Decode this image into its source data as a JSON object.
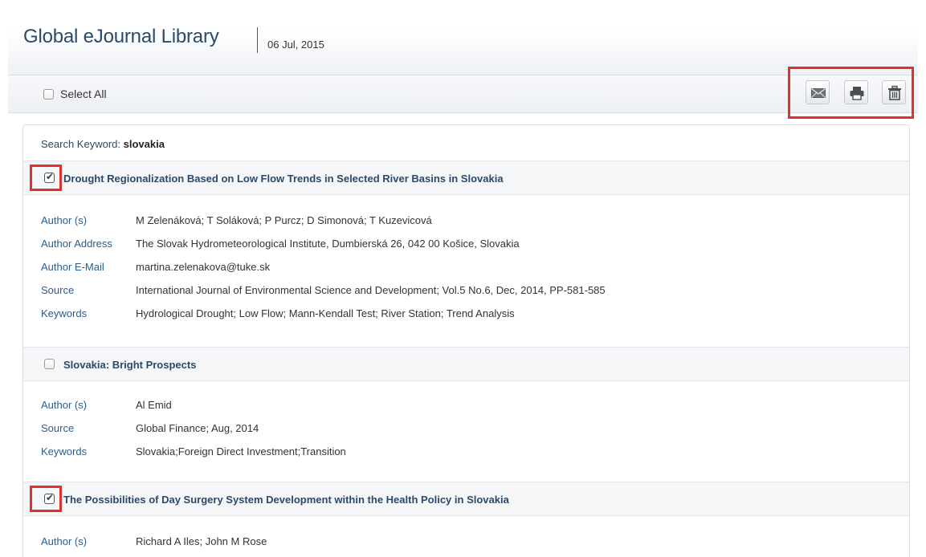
{
  "header": {
    "title": "Global eJournal Library",
    "date": "06 Jul, 2015"
  },
  "toolbar": {
    "select_all_label": "Select All",
    "actions": [
      {
        "icon": "envelope-icon",
        "label": "Email"
      },
      {
        "icon": "printer-icon",
        "label": "Print"
      },
      {
        "icon": "trash-icon",
        "label": "Delete"
      }
    ]
  },
  "search": {
    "label": "Search Keyword:",
    "keyword": "slovakia"
  },
  "records": [
    {
      "checked": true,
      "title": "Drought Regionalization Based on Low Flow Trends in Selected River Basins in Slovakia",
      "fields": [
        {
          "key": "Author (s)",
          "value": "M Zelenáková; T Soláková; P Purcz; D Simonová; T Kuzevicová"
        },
        {
          "key": "Author Address",
          "value": "The Slovak Hydrometeorological Institute, Dumbierská 26, 042 00 Košice, Slovakia"
        },
        {
          "key": "Author E-Mail",
          "value": "martina.zelenakova@tuke.sk"
        },
        {
          "key": "Source",
          "value": "International Journal of Environmental Science and Development; Vol.5 No.6, Dec, 2014, PP-581-585"
        },
        {
          "key": "Keywords",
          "value": "Hydrological Drought; Low Flow; Mann-Kendall Test; River Station; Trend Analysis"
        }
      ]
    },
    {
      "checked": false,
      "title": "Slovakia: Bright Prospects",
      "fields": [
        {
          "key": "Author (s)",
          "value": "Al Emid"
        },
        {
          "key": "Source",
          "value": "Global Finance; Aug, 2014"
        },
        {
          "key": "Keywords",
          "value": "Slovakia;Foreign Direct Investment;Transition"
        }
      ]
    },
    {
      "checked": true,
      "title": "The Possibilities of Day Surgery System Development within the Health Policy in Slovakia",
      "fields": [
        {
          "key": "Author (s)",
          "value": "Richard A Iles; John M Rose"
        }
      ]
    }
  ],
  "colors": {
    "highlight_box": "#e2312d",
    "title_text": "#2b4a6b",
    "field_key": "#2b5d8c"
  }
}
